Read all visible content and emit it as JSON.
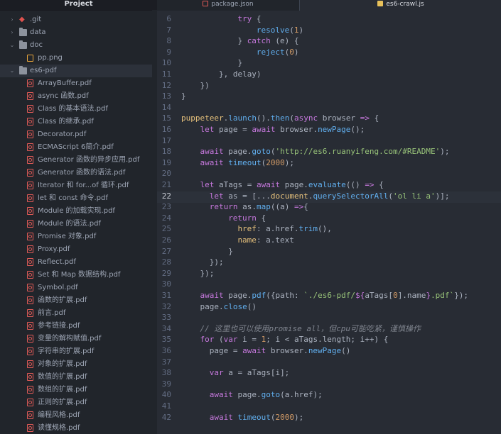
{
  "sidebar": {
    "project_title": "Project",
    "items": [
      {
        "label": ".git",
        "type": "git",
        "indent": 0,
        "chevron": "›"
      },
      {
        "label": "data",
        "type": "folder",
        "indent": 0,
        "chevron": "›"
      },
      {
        "label": "doc",
        "type": "folder",
        "indent": 0,
        "chevron": "⌄"
      },
      {
        "label": "pp.png",
        "type": "image",
        "indent": 1,
        "chevron": ""
      },
      {
        "label": "es6-pdf",
        "type": "folder",
        "indent": 0,
        "chevron": "⌄",
        "selected": true
      },
      {
        "label": "ArrayBuffer.pdf",
        "type": "pdf",
        "indent": 1
      },
      {
        "label": "async 函数.pdf",
        "type": "pdf",
        "indent": 1
      },
      {
        "label": "Class 的基本语法.pdf",
        "type": "pdf",
        "indent": 1
      },
      {
        "label": "Class 的继承.pdf",
        "type": "pdf",
        "indent": 1
      },
      {
        "label": "Decorator.pdf",
        "type": "pdf",
        "indent": 1
      },
      {
        "label": "ECMAScript 6简介.pdf",
        "type": "pdf",
        "indent": 1
      },
      {
        "label": "Generator 函数的异步应用.pdf",
        "type": "pdf",
        "indent": 1
      },
      {
        "label": "Generator 函数的语法.pdf",
        "type": "pdf",
        "indent": 1
      },
      {
        "label": "Iterator 和 for...of 循环.pdf",
        "type": "pdf",
        "indent": 1
      },
      {
        "label": "let 和 const 命令.pdf",
        "type": "pdf",
        "indent": 1
      },
      {
        "label": "Module 的加载实现.pdf",
        "type": "pdf",
        "indent": 1
      },
      {
        "label": "Module 的语法.pdf",
        "type": "pdf",
        "indent": 1
      },
      {
        "label": "Promise 对象.pdf",
        "type": "pdf",
        "indent": 1
      },
      {
        "label": "Proxy.pdf",
        "type": "pdf",
        "indent": 1
      },
      {
        "label": "Reflect.pdf",
        "type": "pdf",
        "indent": 1
      },
      {
        "label": "Set 和 Map 数据结构.pdf",
        "type": "pdf",
        "indent": 1
      },
      {
        "label": "Symbol.pdf",
        "type": "pdf",
        "indent": 1
      },
      {
        "label": "函数的扩展.pdf",
        "type": "pdf",
        "indent": 1
      },
      {
        "label": "前言.pdf",
        "type": "pdf",
        "indent": 1
      },
      {
        "label": "参考链接.pdf",
        "type": "pdf",
        "indent": 1
      },
      {
        "label": "变量的解构赋值.pdf",
        "type": "pdf",
        "indent": 1
      },
      {
        "label": "字符串的扩展.pdf",
        "type": "pdf",
        "indent": 1
      },
      {
        "label": "对象的扩展.pdf",
        "type": "pdf",
        "indent": 1
      },
      {
        "label": "数值的扩展.pdf",
        "type": "pdf",
        "indent": 1
      },
      {
        "label": "数组的扩展.pdf",
        "type": "pdf",
        "indent": 1
      },
      {
        "label": "正则的扩展.pdf",
        "type": "pdf",
        "indent": 1
      },
      {
        "label": "编程风格.pdf",
        "type": "pdf",
        "indent": 1
      },
      {
        "label": "读懂规格.pdf",
        "type": "pdf",
        "indent": 1
      }
    ]
  },
  "tabs": [
    {
      "label": "package.json",
      "icon": "json-file-icon",
      "color": "#e05a57",
      "active": false
    },
    {
      "label": "es6-crawl.js",
      "icon": "js-file-icon",
      "color": "#e8c15a",
      "active": true
    }
  ],
  "editor": {
    "current_line": 22,
    "lines": [
      {
        "n": 6,
        "indent": 6,
        "t": [
          [
            "k",
            "try"
          ],
          [
            "p",
            " {"
          ]
        ]
      },
      {
        "n": 7,
        "indent": 8,
        "t": [
          [
            "f",
            "resolve"
          ],
          [
            "p",
            "("
          ],
          [
            "num",
            "1"
          ],
          [
            "p",
            ")"
          ]
        ]
      },
      {
        "n": 8,
        "indent": 6,
        "t": [
          [
            "p",
            "} "
          ],
          [
            "k",
            "catch"
          ],
          [
            "p",
            " (e) {"
          ]
        ]
      },
      {
        "n": 9,
        "indent": 8,
        "t": [
          [
            "f",
            "reject"
          ],
          [
            "p",
            "("
          ],
          [
            "num",
            "0"
          ],
          [
            "p",
            ")"
          ]
        ]
      },
      {
        "n": 10,
        "indent": 6,
        "t": [
          [
            "p",
            "}"
          ]
        ]
      },
      {
        "n": 11,
        "indent": 4,
        "t": [
          [
            "p",
            "}, delay)"
          ]
        ]
      },
      {
        "n": 12,
        "indent": 2,
        "t": [
          [
            "p",
            "})"
          ]
        ]
      },
      {
        "n": 13,
        "indent": 0,
        "t": [
          [
            "p",
            "}"
          ]
        ]
      },
      {
        "n": 14,
        "indent": 0,
        "t": []
      },
      {
        "n": 15,
        "indent": 0,
        "t": [
          [
            "v",
            "puppeteer"
          ],
          [
            "p",
            "."
          ],
          [
            "f",
            "launch"
          ],
          [
            "p",
            "()."
          ],
          [
            "f",
            "then"
          ],
          [
            "p",
            "("
          ],
          [
            "k",
            "async"
          ],
          [
            "p",
            " browser "
          ],
          [
            "k",
            "=>"
          ],
          [
            "p",
            " {"
          ]
        ]
      },
      {
        "n": 16,
        "indent": 2,
        "t": [
          [
            "k",
            "let"
          ],
          [
            "p",
            " page = "
          ],
          [
            "k",
            "await"
          ],
          [
            "p",
            " browser."
          ],
          [
            "f",
            "newPage"
          ],
          [
            "p",
            "();"
          ]
        ]
      },
      {
        "n": 17,
        "indent": 0,
        "t": []
      },
      {
        "n": 18,
        "indent": 2,
        "t": [
          [
            "k",
            "await"
          ],
          [
            "p",
            " page."
          ],
          [
            "f",
            "goto"
          ],
          [
            "p",
            "("
          ],
          [
            "s",
            "'http://es6.ruanyifeng.com/#README'"
          ],
          [
            "p",
            ");"
          ]
        ]
      },
      {
        "n": 19,
        "indent": 2,
        "t": [
          [
            "k",
            "await"
          ],
          [
            "p",
            " "
          ],
          [
            "f",
            "timeout"
          ],
          [
            "p",
            "("
          ],
          [
            "num",
            "2000"
          ],
          [
            "p",
            ");"
          ]
        ]
      },
      {
        "n": 20,
        "indent": 0,
        "t": []
      },
      {
        "n": 21,
        "indent": 2,
        "t": [
          [
            "k",
            "let"
          ],
          [
            "p",
            " aTags = "
          ],
          [
            "k",
            "await"
          ],
          [
            "p",
            " page."
          ],
          [
            "f",
            "evaluate"
          ],
          [
            "p",
            "(() "
          ],
          [
            "k",
            "=>"
          ],
          [
            "p",
            " {"
          ]
        ]
      },
      {
        "n": 22,
        "indent": 3,
        "t": [
          [
            "k",
            "let"
          ],
          [
            "p",
            " as = [..."
          ],
          [
            "v",
            "document"
          ],
          [
            "p",
            "."
          ],
          [
            "f",
            "querySelectorAll"
          ],
          [
            "p",
            "("
          ],
          [
            "s",
            "'ol li a'"
          ],
          [
            "p",
            ")];"
          ]
        ]
      },
      {
        "n": 23,
        "indent": 3,
        "t": [
          [
            "k",
            "return"
          ],
          [
            "p",
            " as."
          ],
          [
            "f",
            "map"
          ],
          [
            "p",
            "((a) "
          ],
          [
            "k",
            "=>"
          ],
          [
            "p",
            "{"
          ]
        ]
      },
      {
        "n": 24,
        "indent": 5,
        "t": [
          [
            "k",
            "return"
          ],
          [
            "p",
            " {"
          ]
        ]
      },
      {
        "n": 25,
        "indent": 6,
        "t": [
          [
            "a",
            "href"
          ],
          [
            "p",
            ": a.href."
          ],
          [
            "f",
            "trim"
          ],
          [
            "p",
            "(),"
          ]
        ]
      },
      {
        "n": 26,
        "indent": 6,
        "t": [
          [
            "a",
            "name"
          ],
          [
            "p",
            ": a.text"
          ]
        ]
      },
      {
        "n": 27,
        "indent": 5,
        "t": [
          [
            "p",
            "}"
          ]
        ]
      },
      {
        "n": 28,
        "indent": 3,
        "t": [
          [
            "p",
            "});"
          ]
        ]
      },
      {
        "n": 29,
        "indent": 2,
        "t": [
          [
            "p",
            "});"
          ]
        ]
      },
      {
        "n": 30,
        "indent": 0,
        "t": []
      },
      {
        "n": 31,
        "indent": 2,
        "t": [
          [
            "k",
            "await"
          ],
          [
            "p",
            " page."
          ],
          [
            "f",
            "pdf"
          ],
          [
            "p",
            "({path: "
          ],
          [
            "s",
            "`./es6-pdf/"
          ],
          [
            "k",
            "${"
          ],
          [
            "p",
            "aTags["
          ],
          [
            "num",
            "0"
          ],
          [
            "p",
            "].name"
          ],
          [
            "k",
            "}"
          ],
          [
            "s",
            ".pdf`"
          ],
          [
            "p",
            "});"
          ]
        ]
      },
      {
        "n": 32,
        "indent": 2,
        "t": [
          [
            "p",
            "page."
          ],
          [
            "f",
            "close"
          ],
          [
            "p",
            "()"
          ]
        ]
      },
      {
        "n": 33,
        "indent": 0,
        "t": []
      },
      {
        "n": 34,
        "indent": 2,
        "t": [
          [
            "c",
            "// 这里也可以使用promise all，但cpu可能吃紧，谨慎操作"
          ]
        ]
      },
      {
        "n": 35,
        "indent": 2,
        "t": [
          [
            "k",
            "for"
          ],
          [
            "p",
            " ("
          ],
          [
            "k",
            "var"
          ],
          [
            "p",
            " i = "
          ],
          [
            "num",
            "1"
          ],
          [
            "p",
            "; i < aTags.length; i++) {"
          ]
        ]
      },
      {
        "n": 36,
        "indent": 3,
        "t": [
          [
            "p",
            "page = "
          ],
          [
            "k",
            "await"
          ],
          [
            "p",
            " browser."
          ],
          [
            "f",
            "newPage"
          ],
          [
            "p",
            "()"
          ]
        ]
      },
      {
        "n": 37,
        "indent": 0,
        "t": []
      },
      {
        "n": 38,
        "indent": 3,
        "t": [
          [
            "k",
            "var"
          ],
          [
            "p",
            " a = aTags[i];"
          ]
        ]
      },
      {
        "n": 39,
        "indent": 0,
        "t": []
      },
      {
        "n": 40,
        "indent": 3,
        "t": [
          [
            "k",
            "await"
          ],
          [
            "p",
            " page."
          ],
          [
            "f",
            "goto"
          ],
          [
            "p",
            "(a.href);"
          ]
        ]
      },
      {
        "n": 41,
        "indent": 0,
        "t": []
      },
      {
        "n": 42,
        "indent": 3,
        "t": [
          [
            "k",
            "await"
          ],
          [
            "p",
            " "
          ],
          [
            "f",
            "timeout"
          ],
          [
            "p",
            "("
          ],
          [
            "num",
            "2000"
          ],
          [
            "p",
            ");"
          ]
        ]
      }
    ]
  },
  "colors": {
    "keyword": "#c678dd",
    "function": "#61afef",
    "string": "#98c379",
    "number": "#d19a66",
    "attribute": "#e5c07b",
    "variable": "#e5c07b",
    "comment": "#7f848e",
    "plain": "#abb2bf"
  }
}
